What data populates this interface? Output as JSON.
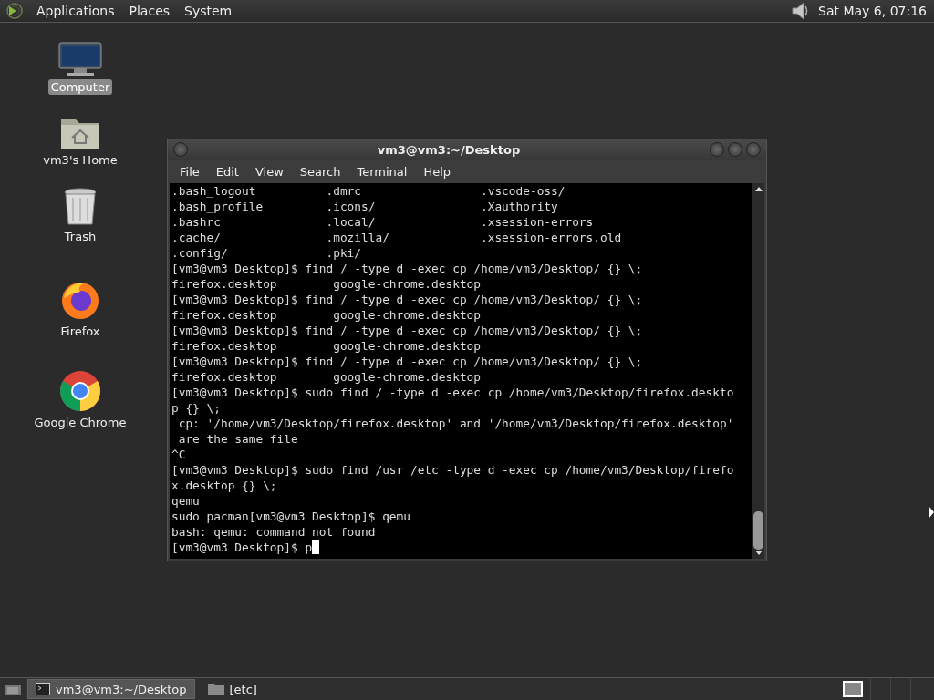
{
  "top_panel": {
    "menus": [
      "Applications",
      "Places",
      "System"
    ],
    "clock": "Sat May  6, 07:16"
  },
  "desktop_icons": [
    {
      "kind": "computer",
      "label": "Computer",
      "selected": true
    },
    {
      "kind": "home",
      "label": "vm3's Home",
      "selected": false
    },
    {
      "kind": "trash",
      "label": "Trash",
      "selected": false
    },
    {
      "kind": "firefox",
      "label": "Firefox",
      "selected": false
    },
    {
      "kind": "chrome",
      "label": "Google Chrome",
      "selected": false
    }
  ],
  "terminal": {
    "title": "vm3@vm3:~/Desktop",
    "menu": [
      "File",
      "Edit",
      "View",
      "Search",
      "Terminal",
      "Help"
    ],
    "lines": [
      ".bash_logout          .dmrc                 .vscode-oss/",
      ".bash_profile         .icons/               .Xauthority",
      ".bashrc               .local/               .xsession-errors",
      ".cache/               .mozilla/             .xsession-errors.old",
      ".config/              .pki/",
      "[vm3@vm3 Desktop]$ find / -type d -exec cp /home/vm3/Desktop/ {} \\;",
      "firefox.desktop        google-chrome.desktop",
      "[vm3@vm3 Desktop]$ find / -type d -exec cp /home/vm3/Desktop/ {} \\;",
      "firefox.desktop        google-chrome.desktop",
      "[vm3@vm3 Desktop]$ find / -type d -exec cp /home/vm3/Desktop/ {} \\;",
      "firefox.desktop        google-chrome.desktop",
      "[vm3@vm3 Desktop]$ find / -type d -exec cp /home/vm3/Desktop/ {} \\;",
      "firefox.desktop        google-chrome.desktop",
      "[vm3@vm3 Desktop]$ sudo find / -type d -exec cp /home/vm3/Desktop/firefox.deskto",
      "p {} \\;",
      " cp: '/home/vm3/Desktop/firefox.desktop' and '/home/vm3/Desktop/firefox.desktop'",
      " are the same file",
      "^C",
      "[vm3@vm3 Desktop]$ sudo find /usr /etc -type d -exec cp /home/vm3/Desktop/firefo",
      "x.desktop {} \\;",
      "qemu",
      "sudo pacman[vm3@vm3 Desktop]$ qemu",
      "bash: qemu: command not found",
      "[vm3@vm3 Desktop]$ p"
    ]
  },
  "taskbar": {
    "items": [
      {
        "kind": "terminal",
        "label": "vm3@vm3:~/Desktop",
        "selected": true
      },
      {
        "kind": "folder",
        "label": "[etc]",
        "selected": false
      }
    ],
    "workspaces": [
      {
        "selected": true
      },
      {
        "selected": false
      },
      {
        "selected": false
      },
      {
        "selected": false
      }
    ]
  }
}
